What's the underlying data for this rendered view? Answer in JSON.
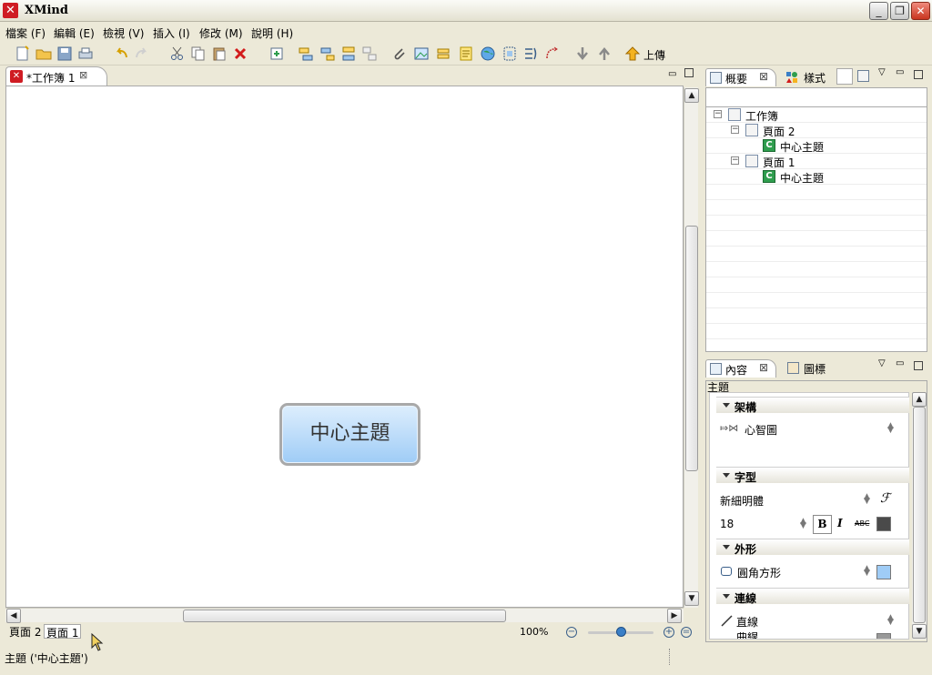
{
  "window": {
    "title": "XMind",
    "icon": "xmind-icon",
    "controls": {
      "minimize": "_",
      "restore": "❐",
      "close": "✕"
    }
  },
  "menubar": [
    {
      "label": "檔案 (F)"
    },
    {
      "label": "編輯 (E)"
    },
    {
      "label": "檢視 (V)"
    },
    {
      "label": "插入 (I)"
    },
    {
      "label": "修改 (M)"
    },
    {
      "label": "說明 (H)"
    }
  ],
  "toolbar": {
    "upload_label": "上傳"
  },
  "editor": {
    "tab_label": "*工作簿 1",
    "central_topic": "中心主題",
    "sheet_tabs": [
      "頁面 2",
      "頁面 1"
    ],
    "active_sheet": "頁面 1",
    "zoom": "100%"
  },
  "status": {
    "text": "主題 ('中心主題')"
  },
  "outline_pane": {
    "tabs": [
      "概要",
      "樣式"
    ],
    "tree": [
      {
        "label": "工作簿",
        "type": "workbook"
      },
      {
        "label": "頁面 2",
        "type": "page"
      },
      {
        "label": "中心主題",
        "type": "topic"
      },
      {
        "label": "頁面 1",
        "type": "page"
      },
      {
        "label": "中心主題",
        "type": "topic"
      }
    ]
  },
  "properties_pane": {
    "tabs": [
      "內容",
      "圖標"
    ],
    "heading": "主題",
    "sections": {
      "structure": {
        "title": "架構",
        "value": "心智圖"
      },
      "font": {
        "title": "字型",
        "family": "新細明體",
        "size": "18",
        "bold": "B",
        "italic": "I",
        "strike": "ABC",
        "font_button": "ℱ"
      },
      "shape": {
        "title": "外形",
        "value": "圓角方形",
        "fill_color": "#9fccf6"
      },
      "line": {
        "title": "連線",
        "value": "直線",
        "partial": "曲線"
      }
    }
  },
  "colors": {
    "chrome": "#ece9d8",
    "topic_fill_top": "#ddeefd",
    "topic_fill_bottom": "#9fccf6",
    "brand_red": "#cf1c23"
  }
}
